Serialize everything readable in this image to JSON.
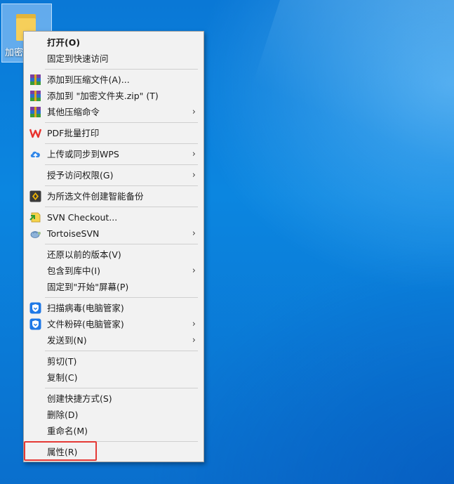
{
  "desktop": {
    "icon_label": "加密",
    "icon_name": "folder-icon"
  },
  "context_menu": {
    "items": [
      {
        "label": "打开(O)",
        "bold": true
      },
      {
        "label": "固定到快速访问"
      },
      {
        "label": "添加到压缩文件(A)...",
        "icon": "winrar-archive-icon"
      },
      {
        "label": "添加到 \"加密文件夹.zip\" (T)",
        "icon": "winrar-archive-icon"
      },
      {
        "label": "其他压缩命令",
        "icon": "winrar-archive-icon",
        "submenu": true
      },
      {
        "label": "PDF批量打印",
        "icon": "wps-logo-icon"
      },
      {
        "label": "上传或同步到WPS",
        "icon": "cloud-upload-icon",
        "submenu": true
      },
      {
        "label": "授予访问权限(G)",
        "submenu": true
      },
      {
        "label": "为所选文件创建智能备份",
        "icon": "backup-icon"
      },
      {
        "label": "SVN Checkout...",
        "icon": "svn-checkout-icon"
      },
      {
        "label": "TortoiseSVN",
        "icon": "tortoise-icon",
        "submenu": true
      },
      {
        "label": "还原以前的版本(V)"
      },
      {
        "label": "包含到库中(I)",
        "submenu": true
      },
      {
        "label": "固定到\"开始\"屏幕(P)"
      },
      {
        "label": "扫描病毒(电脑管家)",
        "icon": "shield-icon"
      },
      {
        "label": "文件粉碎(电脑管家)",
        "icon": "shield-icon",
        "submenu": true
      },
      {
        "label": "发送到(N)",
        "submenu": true
      },
      {
        "label": "剪切(T)"
      },
      {
        "label": "复制(C)"
      },
      {
        "label": "创建快捷方式(S)"
      },
      {
        "label": "删除(D)"
      },
      {
        "label": "重命名(M)"
      },
      {
        "label": "属性(R)"
      }
    ],
    "submenu_arrow": "›"
  },
  "colors": {
    "highlight_box": "#e53935",
    "wps_red": "#e8322e",
    "shield_blue": "#1e78e6"
  }
}
